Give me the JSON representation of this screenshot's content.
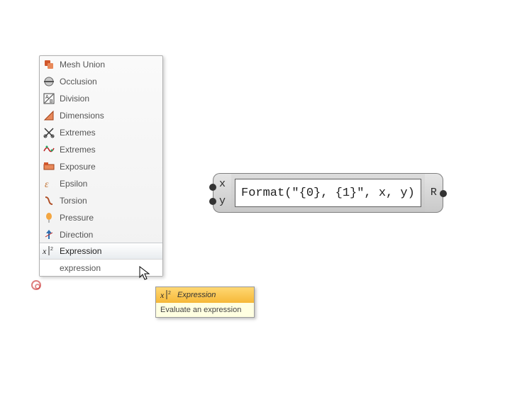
{
  "menu": {
    "items": [
      {
        "label": "Mesh Union",
        "icon": "mesh-union-icon"
      },
      {
        "label": "Occlusion",
        "icon": "occlusion-icon"
      },
      {
        "label": "Division",
        "icon": "division-icon"
      },
      {
        "label": "Dimensions",
        "icon": "dimensions-icon"
      },
      {
        "label": "Extremes",
        "icon": "extremes-scissor-icon"
      },
      {
        "label": "Extremes",
        "icon": "extremes-wave-icon"
      },
      {
        "label": "Exposure",
        "icon": "exposure-icon"
      },
      {
        "label": "Epsilon",
        "icon": "epsilon-icon"
      },
      {
        "label": "Torsion",
        "icon": "torsion-icon"
      },
      {
        "label": "Pressure",
        "icon": "pressure-icon"
      },
      {
        "label": "Direction",
        "icon": "direction-icon"
      },
      {
        "label": "Expression",
        "icon": "expression-icon",
        "highlighted": true
      }
    ],
    "search_value": "expression"
  },
  "tooltip": {
    "title": "Expression",
    "body": "Evaluate an expression"
  },
  "node": {
    "inputs": [
      "x",
      "y"
    ],
    "output": "R",
    "expression": "Format(\"{0}, {1}\", x, y)"
  }
}
